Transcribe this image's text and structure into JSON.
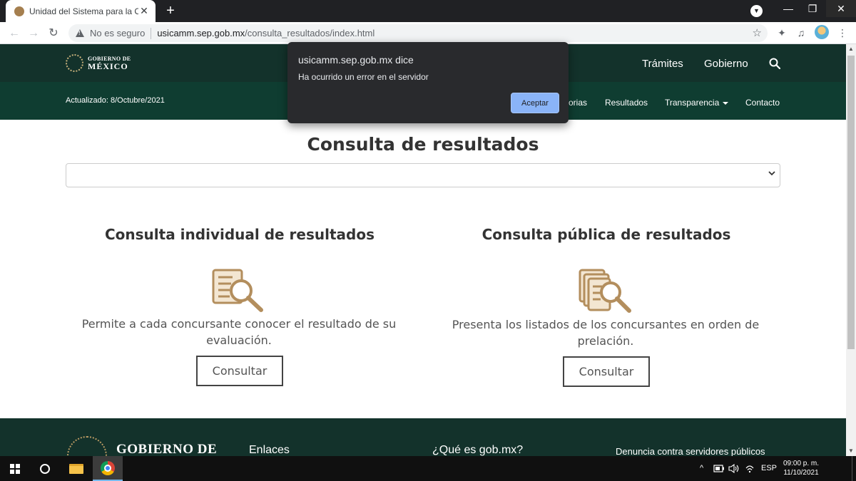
{
  "browser": {
    "tab_title": "Unidad del Sistema para la Carre",
    "tab_close": "✕",
    "new_tab": "+",
    "address": {
      "security_label": "No es seguro",
      "url_host": "usicamm.sep.gob.mx",
      "url_path": "/consulta_resultados/index.html"
    },
    "icons": {
      "back": "←",
      "forward": "→",
      "reload": "↻",
      "star": "☆",
      "extensions": "✦",
      "media": "♫",
      "menu": "⋮",
      "minimize": "—",
      "maximize": "❐",
      "close": "✕",
      "tab_search": "▼"
    }
  },
  "site": {
    "logo": {
      "line1": "GOBIERNO DE",
      "line2": "MÉXICO"
    },
    "top_nav": [
      "Trámites",
      "Gobierno"
    ],
    "updated": "Actualizado: 8/Octubre/2021",
    "sub_nav": {
      "partial": "orias",
      "resultados": "Resultados",
      "transparencia": "Transparencia",
      "contacto": "Contacto"
    }
  },
  "main": {
    "title": "Consulta de resultados",
    "select_value": "",
    "cards": [
      {
        "title": "Consulta individual de resultados",
        "description": "Permite a cada concursante conocer el resultado de su evaluación.",
        "button": "Consultar",
        "icon": "document-search-icon"
      },
      {
        "title": "Consulta pública de resultados",
        "description": "Presenta los listados de los concursantes en orden de prelación.",
        "button": "Consultar",
        "icon": "documents-stack-search-icon"
      }
    ]
  },
  "footer": {
    "logo": "GOBIERNO DE",
    "links": [
      "Enlaces",
      "¿Qué es gob.mx?",
      "Denuncia contra servidores públicos"
    ]
  },
  "dialog": {
    "title": "usicamm.sep.gob.mx dice",
    "message": "Ha ocurrido un error en el servidor",
    "button": "Aceptar"
  },
  "taskbar": {
    "language": "ESP",
    "time": "09:00 p. m.",
    "date": "11/10/2021",
    "tray_chevron": "^"
  },
  "colors": {
    "header_dark": "#13322b",
    "subheader": "#0f3d31",
    "icon_gold": "#b38e5d",
    "dialog_bg": "#292a2d",
    "dialog_button": "#8ab4f8"
  }
}
